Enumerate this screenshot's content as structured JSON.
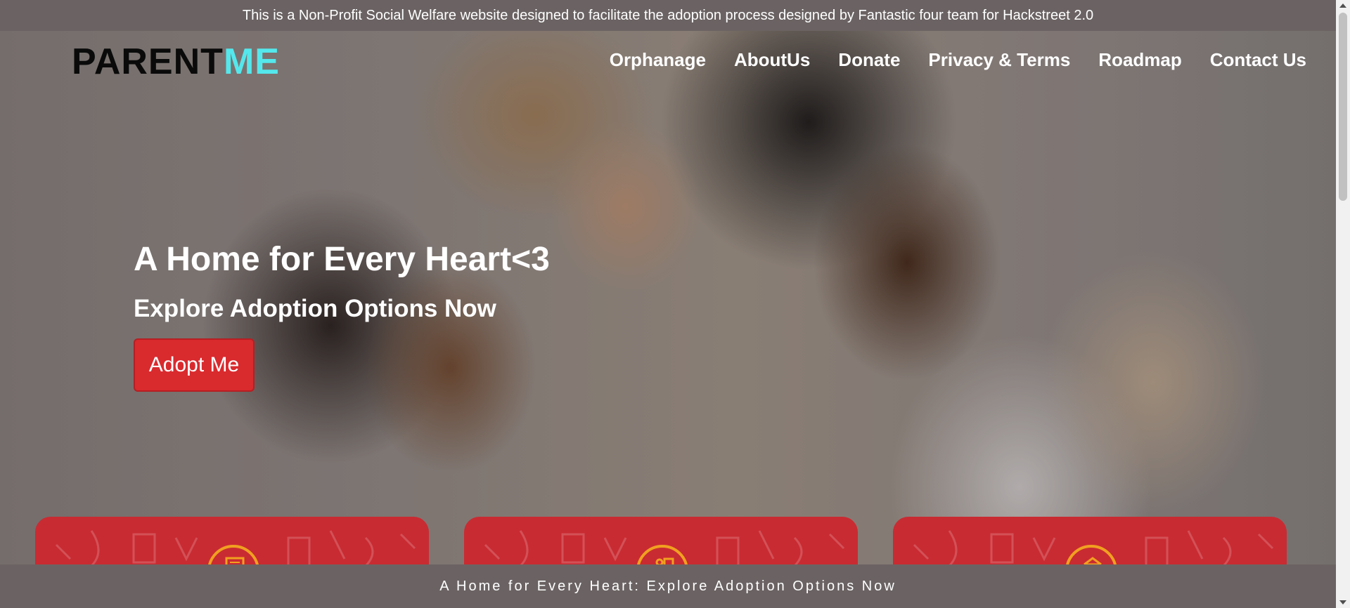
{
  "announcement": "This is a Non-Profit Social Welfare website designed to facilitate the adoption process designed by Fantastic four team for Hackstreet 2.0",
  "logo": {
    "part1": "PARENT",
    "part2": "ME",
    "color_part2": "#54e8ec"
  },
  "nav": {
    "items": [
      {
        "label": "Orphanage"
      },
      {
        "label": "AboutUs"
      },
      {
        "label": "Donate"
      },
      {
        "label": "Privacy & Terms"
      },
      {
        "label": "Roadmap"
      },
      {
        "label": "Contact Us"
      }
    ]
  },
  "hero": {
    "title": "A Home for Every Heart<3",
    "subtitle": "Explore Adoption Options Now",
    "cta_label": "Adopt Me",
    "cta_color": "#d92a2e"
  },
  "cards": [
    {
      "icon": "certificate-icon"
    },
    {
      "icon": "family-photo-icon"
    },
    {
      "icon": "home-icon"
    }
  ],
  "card_color": "#c92b32",
  "bottom_bar": "A Home for Every Heart: Explore Adoption Options Now"
}
